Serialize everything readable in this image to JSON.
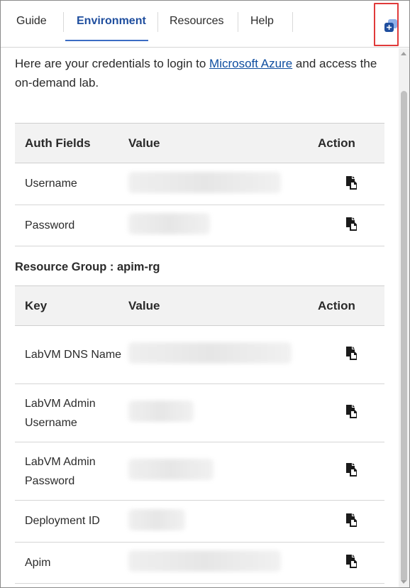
{
  "tabs": [
    {
      "label": "Guide",
      "active": false
    },
    {
      "label": "Environment",
      "active": true
    },
    {
      "label": "Resources",
      "active": false
    },
    {
      "label": "Help",
      "active": false
    }
  ],
  "toolbar": {
    "popout_icon": "popout-window-icon"
  },
  "intro": {
    "before_link": "Here are your credentials to login to ",
    "link_text": "Microsoft Azure",
    "after_link": " and access the on-demand lab."
  },
  "auth_table": {
    "headers": [
      "Auth Fields",
      "Value",
      "Action"
    ],
    "rows": [
      {
        "field": "Username"
      },
      {
        "field": "Password"
      }
    ]
  },
  "resource_group": {
    "label": "Resource Group : apim-rg"
  },
  "resource_table": {
    "headers": [
      "Key",
      "Value",
      "Action"
    ],
    "rows": [
      {
        "key": "LabVM DNS Name"
      },
      {
        "key": "LabVM Admin Username"
      },
      {
        "key": "LabVM Admin Password"
      },
      {
        "key": "Deployment ID"
      },
      {
        "key": "Apim"
      }
    ]
  },
  "colors": {
    "accent": "#1f4e9e",
    "link": "#0f4ea0",
    "highlight_border": "#e03a3a",
    "header_bg": "#f2f2f2"
  }
}
